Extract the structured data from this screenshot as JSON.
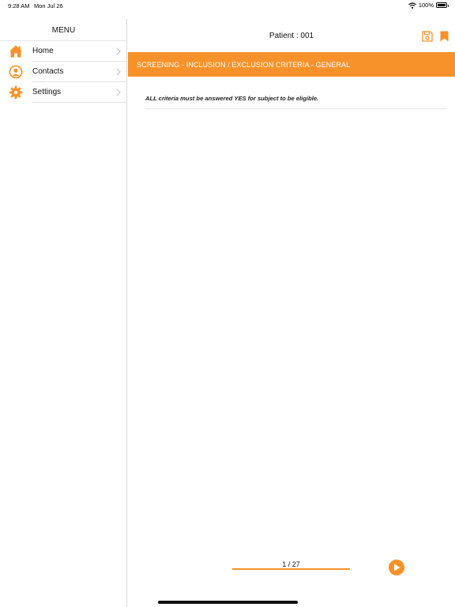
{
  "status_bar": {
    "time": "9:28 AM",
    "date": "Mon Jul 26",
    "battery": "100%",
    "battery_level": 1.0
  },
  "sidebar": {
    "title": "MENU",
    "items": [
      {
        "label": "Home",
        "icon": "home-icon"
      },
      {
        "label": "Contacts",
        "icon": "user-circle-icon"
      },
      {
        "label": "Settings",
        "icon": "gear-icon"
      }
    ]
  },
  "header": {
    "title": "Patient : 001",
    "actions": [
      "save-icon",
      "bookmark-icon"
    ]
  },
  "section": {
    "title": "SCREENING - INCLUSION / EXCLUSION CRITERIA - GENERAL"
  },
  "form": {
    "instruction": "ALL criteria must be answered YES for subject to be eligible."
  },
  "pager": {
    "current": 1,
    "total": 27,
    "label": "1 / 27",
    "progress": 1.0
  },
  "colors": {
    "accent": "#f7922a",
    "banner_text": "#ffffff"
  }
}
